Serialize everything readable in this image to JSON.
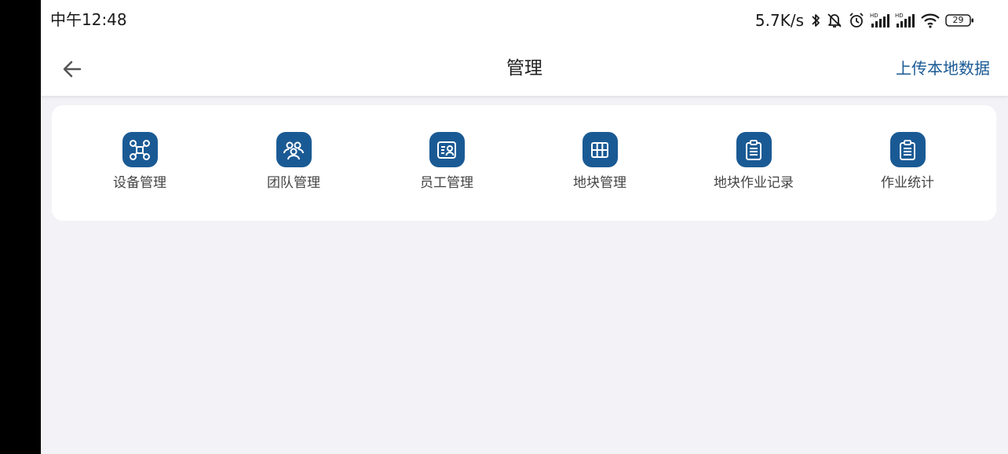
{
  "status_bar": {
    "time": "中午12:48",
    "net_speed": "5.7K/s",
    "battery": "29",
    "icons": [
      "bluetooth-icon",
      "mute-bell-icon",
      "alarm-icon",
      "signal-hd-icon",
      "signal-hd-icon",
      "wifi-icon",
      "battery-icon"
    ]
  },
  "app_bar": {
    "title": "管理",
    "action": "上传本地数据",
    "back_icon": "back-arrow-icon"
  },
  "menu": {
    "items": [
      {
        "label": "设备管理",
        "icon": "drone-icon"
      },
      {
        "label": "团队管理",
        "icon": "team-icon"
      },
      {
        "label": "员工管理",
        "icon": "employee-card-icon"
      },
      {
        "label": "地块管理",
        "icon": "field-map-icon"
      },
      {
        "label": "地块作业记录",
        "icon": "clipboard-icon"
      },
      {
        "label": "作业统计",
        "icon": "clipboard-icon"
      }
    ]
  },
  "colors": {
    "accent": "#1a5a94",
    "background": "#f3f3f7",
    "card": "#ffffff"
  }
}
